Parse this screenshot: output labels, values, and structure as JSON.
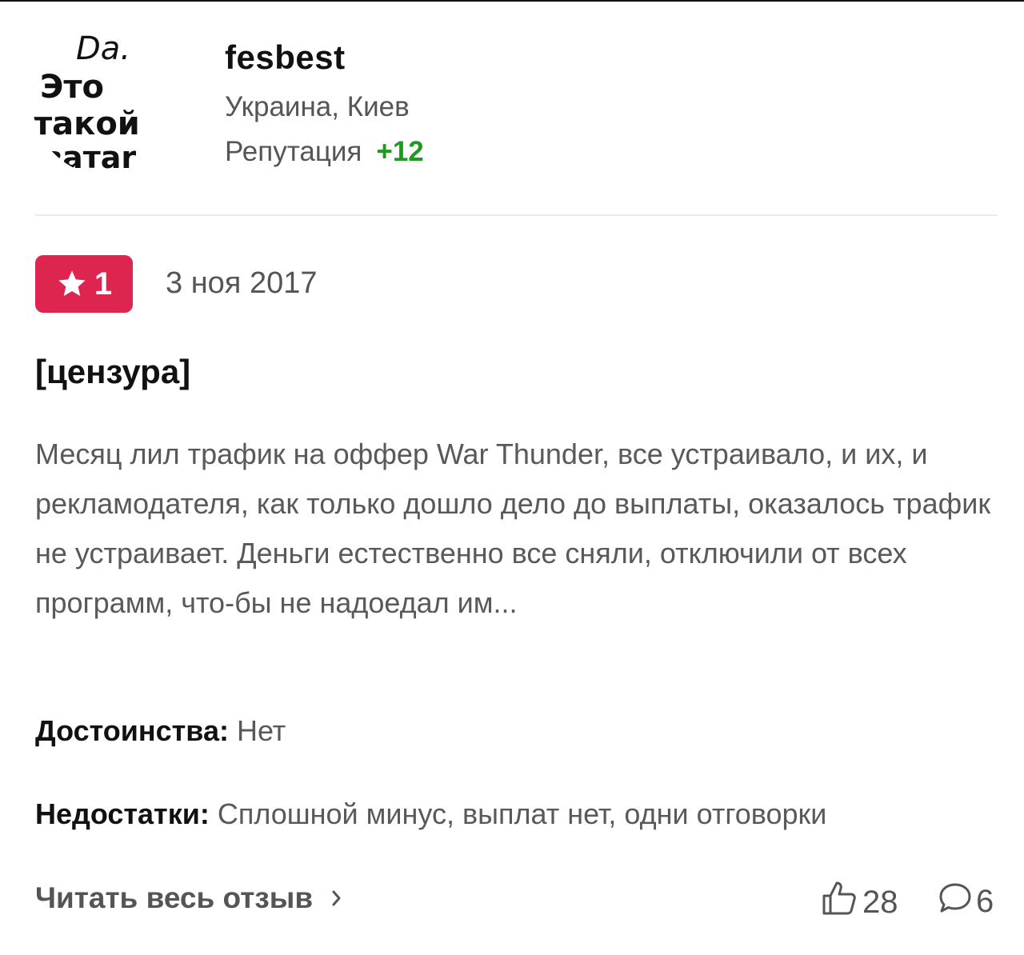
{
  "user": {
    "avatar_text": [
      "Da.",
      "Это",
      "такой",
      "ватаr"
    ],
    "name": "fesbest",
    "location": "Украина, Киев",
    "reputation_label": "Репутация",
    "reputation_value": "+12"
  },
  "review": {
    "rating": "1",
    "date": "3 ноя 2017",
    "title": "[цензура]",
    "body": "Месяц лил трафик на оффер War Thunder, все устраивало, и их, и рекламодателя, как только дошло дело до выплаты, оказалось трафик не устраивает. Деньги естественно все сняли, отключили от всех программ, что-бы не надоедал им...",
    "pros_label": "Достоинства:",
    "pros_text": " Нет",
    "cons_label": "Недостатки:",
    "cons_text": " Сплошной минус, выплат нет, одни отговорки"
  },
  "footer": {
    "read_more_label": "Читать весь отзыв",
    "likes_count": "28",
    "comments_count": "6"
  },
  "colors": {
    "badge": "#de2550",
    "reputation_positive": "#1e9b1e"
  },
  "icons": {
    "rating": "star-icon",
    "read_more": "chevron-right-icon",
    "likes": "thumbs-up-icon",
    "comments": "comment-icon"
  }
}
